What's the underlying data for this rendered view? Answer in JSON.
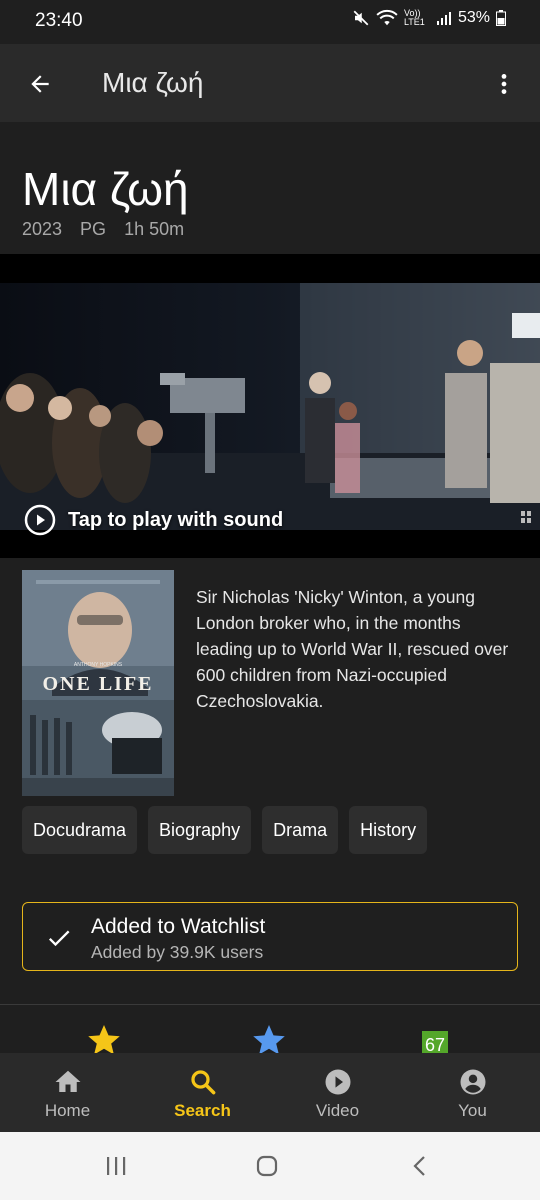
{
  "status_bar": {
    "time": "23:40",
    "network_label": "Vo)) LTE1",
    "battery": "53%"
  },
  "app_bar": {
    "title": "Μια ζωή"
  },
  "movie": {
    "title": "Μια ζωή",
    "year": "2023",
    "rating": "PG",
    "runtime": "1h 50m",
    "plot": "Sir Nicholas 'Nicky' Winton, a young London broker who, in the months leading up to World War II, rescued over 600 children from Nazi-occupied Czechoslovakia.",
    "poster_title": "ONE LIFE",
    "poster_actor": "ANTHONY HOPKINS"
  },
  "video": {
    "play_label": "Tap to play with sound"
  },
  "genres": [
    "Docudrama",
    "Biography",
    "Drama",
    "History"
  ],
  "watchlist": {
    "title": "Added to Watchlist",
    "subtitle": "Added by 39.9K users",
    "accent_color": "#e5b51b"
  },
  "ratings_peek": {
    "metascore": "67",
    "metascore_color": "#54a72a"
  },
  "bottom_nav": {
    "items": [
      {
        "label": "Home",
        "icon": "home-icon"
      },
      {
        "label": "Search",
        "icon": "search-icon"
      },
      {
        "label": "Video",
        "icon": "play-circle-icon"
      },
      {
        "label": "You",
        "icon": "account-icon"
      }
    ],
    "active": "Search",
    "active_color": "#f5c518"
  }
}
